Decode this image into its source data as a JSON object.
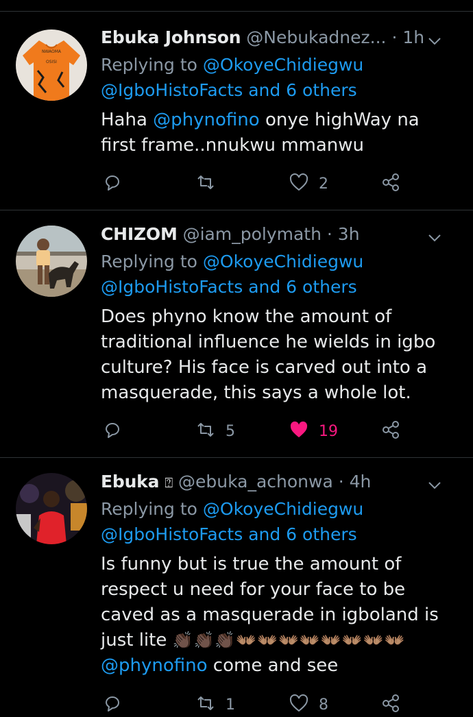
{
  "tweets": [
    {
      "name": "Ebuka Johnson",
      "handle": "@Nebukadnez...",
      "time": "· 1h",
      "reply_prefix": "Replying to ",
      "reply_to_1": "@OkoyeChidiegwu",
      "reply_to_2": "@IgboHistoFacts and 6 others",
      "body_pre": "Haha ",
      "body_mention": "@phynofino",
      "body_post": " onye highWay na first frame..nnukwu mmanwu",
      "replies": "",
      "retweets": "",
      "likes": "2",
      "liked": false
    },
    {
      "name": "CHIZOM",
      "handle": "@iam_polymath",
      "time": "· 3h",
      "reply_prefix": "Replying to ",
      "reply_to_1": "@OkoyeChidiegwu",
      "reply_to_2": "@IgboHistoFacts and 6 others",
      "body": "Does phyno know the amount of traditional influence he wields in igbo culture? His face is carved out into a masquerade, this says a whole lot.",
      "replies": "",
      "retweets": "5",
      "likes": "19",
      "liked": true
    },
    {
      "name": "Ebuka",
      "name_glyph": "⍰",
      "handle": "@ebuka_achonwa",
      "time": "· 4h",
      "reply_prefix": "Replying to ",
      "reply_to_1": "@OkoyeChidiegwu",
      "reply_to_2": "@IgboHistoFacts and 6 others",
      "body_pre": "Is funny but is true the amount of respect u need for your face  to be caved as a masquerade in igboland is just lite ",
      "body_emoji": "👏🏿👏🏿👏🏿👐🏽👐🏽👐🏽👐🏽👐🏽👐🏽👐🏽👐🏽",
      "body_mention": "@phynofino",
      "body_post": " come and see",
      "replies": "",
      "retweets": "1",
      "likes": "8",
      "liked": false
    }
  ],
  "avatars": {
    "t1_shirt_text_top": "NWAOMA",
    "t1_shirt_text_bottom": "OSISI"
  },
  "colors": {
    "background": "#000000",
    "text": "#e7e9ea",
    "muted": "#8b98a5",
    "link": "#1d9bf0",
    "like": "#f91880",
    "divider": "#2f3336"
  },
  "icons": [
    "reply-icon",
    "retweet-icon",
    "like-icon",
    "share-icon",
    "chevron-down-icon"
  ]
}
